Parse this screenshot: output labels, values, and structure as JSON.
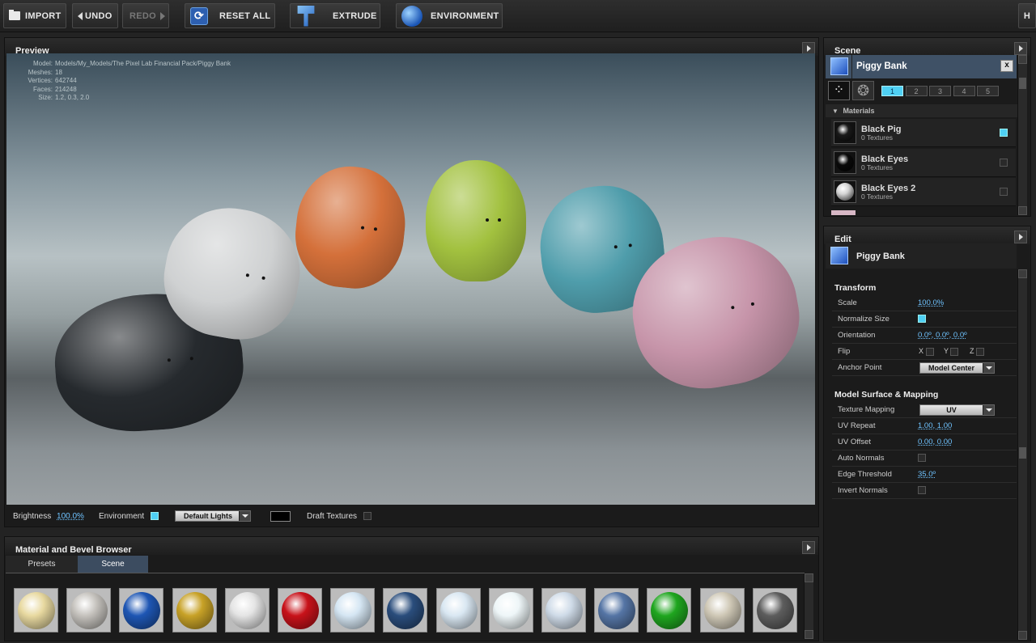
{
  "toolbar": {
    "import": "IMPORT",
    "undo": "UNDO",
    "redo": "REDO",
    "reset_all": "RESET ALL",
    "extrude": "EXTRUDE",
    "environment": "ENVIRONMENT",
    "right_btn": "H"
  },
  "preview": {
    "title": "Preview",
    "info": [
      {
        "k": "Model:",
        "v": "Models/My_Models/The Pixel Lab Financial Pack/Piggy Bank"
      },
      {
        "k": "Meshes:",
        "v": "18"
      },
      {
        "k": "Vertices:",
        "v": "642744"
      },
      {
        "k": "Faces:",
        "v": "214248"
      },
      {
        "k": "Size:",
        "v": "1.2, 0.3, 2.0"
      }
    ],
    "pigs": [
      {
        "color": "#262a2e"
      },
      {
        "color": "#cfd1d2"
      },
      {
        "color": "#d4703a"
      },
      {
        "color": "#a2c13f"
      },
      {
        "color": "#4f9dab"
      },
      {
        "color": "#c694a9"
      }
    ],
    "footer": {
      "brightness_label": "Brightness",
      "brightness_value": "100.0%",
      "environment_label": "Environment",
      "environment_checked": true,
      "lights_value": "Default Lights",
      "draft_label": "Draft Textures",
      "draft_checked": false,
      "color_swatch": "#000000"
    }
  },
  "browser": {
    "title": "Material and Bevel Browser",
    "tabs": [
      "Presets",
      "Scene"
    ],
    "active_tab": "Scene",
    "materials": [
      {
        "icon": "chrome-glow-material-icon",
        "color": "#e8d9a0"
      },
      {
        "icon": "silver-material-icon",
        "color": "#c5c2bd"
      },
      {
        "icon": "blue-plastic-material-icon",
        "color": "#1e56b4"
      },
      {
        "icon": "gold-material-icon",
        "color": "#c8a227"
      },
      {
        "icon": "striped-material-icon",
        "color": "#e4e4e4"
      },
      {
        "icon": "red-plastic-material-icon",
        "color": "#c8121a"
      },
      {
        "icon": "flag-blue-material-icon",
        "color": "#d5e6f3"
      },
      {
        "icon": "navy-material-icon",
        "color": "#2a4d7c"
      },
      {
        "icon": "flag-material-icon",
        "color": "#d9e7f2"
      },
      {
        "icon": "white-glow-material-icon",
        "color": "#eef6f8"
      },
      {
        "icon": "flag-text-material-icon",
        "color": "#cfdbe8"
      },
      {
        "icon": "blue-metal-material-icon",
        "color": "#5575a5"
      },
      {
        "icon": "green-plastic-material-icon",
        "color": "#1fa61f"
      },
      {
        "icon": "wood-material-icon",
        "color": "#cfc8b6"
      },
      {
        "icon": "dark-gray-material-icon",
        "color": "#5d5d5d"
      }
    ]
  },
  "scene": {
    "title": "Scene",
    "object_name": "Piggy Bank",
    "close_label": "x",
    "pages": [
      "1",
      "2",
      "3",
      "4",
      "5"
    ],
    "active_page": "1",
    "materials_label": "Materials",
    "materials": [
      {
        "name": "Black Pig",
        "textures": "0 Textures",
        "checked": true,
        "color": "#1a1a1a"
      },
      {
        "name": "Black Eyes",
        "textures": "0 Textures",
        "checked": false,
        "color": "#0a0a0a"
      },
      {
        "name": "Black Eyes 2",
        "textures": "0 Textures",
        "checked": false,
        "color": "#d4d4d4"
      }
    ]
  },
  "edit": {
    "title": "Edit",
    "object_name": "Piggy Bank",
    "transform": {
      "title": "Transform",
      "scale_label": "Scale",
      "scale": "100.0%",
      "normalize_label": "Normalize Size",
      "normalize": true,
      "orientation_label": "Orientation",
      "orientation": "0.0º, 0.0º, 0.0º",
      "flip_label": "Flip",
      "flip_x": "X",
      "flip_y": "Y",
      "flip_z": "Z",
      "anchor_label": "Anchor Point",
      "anchor": "Model Center"
    },
    "surface": {
      "title": "Model Surface & Mapping",
      "texture_mapping_label": "Texture Mapping",
      "texture_mapping": "UV",
      "uv_repeat_label": "UV Repeat",
      "uv_repeat": "1.00, 1.00",
      "uv_offset_label": "UV Offset",
      "uv_offset": "0.00, 0.00",
      "auto_normals_label": "Auto Normals",
      "auto_normals": false,
      "edge_threshold_label": "Edge Threshold",
      "edge_threshold": "35.0º",
      "invert_normals_label": "Invert Normals",
      "invert_normals": false
    }
  },
  "colors": {
    "accent": "#4fd0f4",
    "link": "#6fc3ff",
    "cube": "#2e6be0"
  }
}
